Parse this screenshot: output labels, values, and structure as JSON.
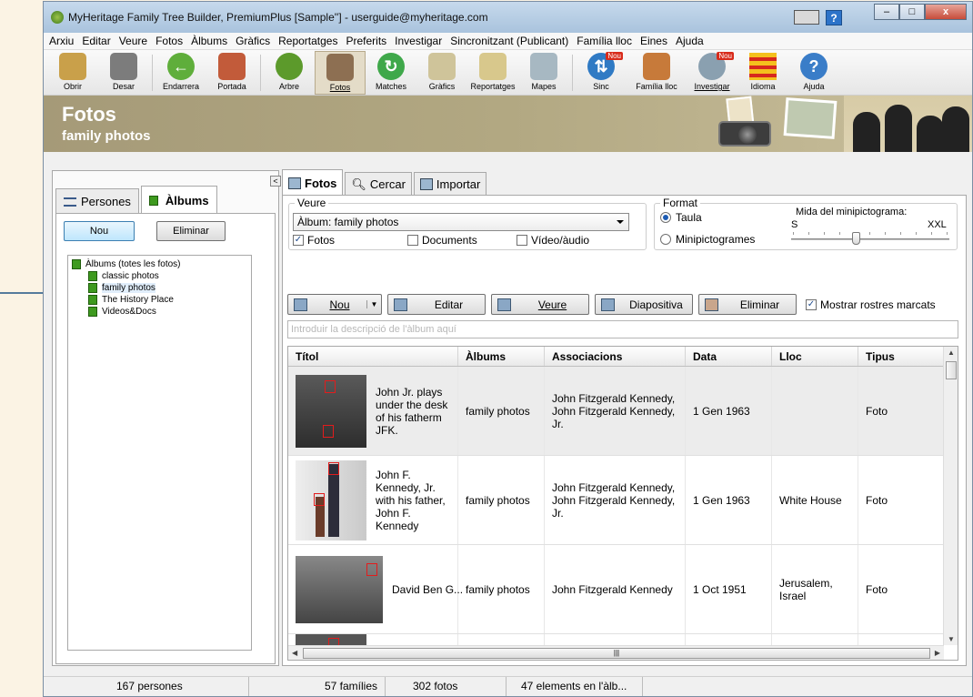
{
  "window": {
    "title": "MyHeritage Family Tree Builder, PremiumPlus [Sample''] - userguide@myheritage.com"
  },
  "menu": [
    "Arxiu",
    "Editar",
    "Veure",
    "Fotos",
    "Àlbums",
    "Gràfics",
    "Reportatges",
    "Preferits",
    "Investigar",
    "Sincronitzant (Publicant)",
    "Família lloc",
    "Eines",
    "Ajuda"
  ],
  "toolbar": {
    "open": "Obrir",
    "save": "Desar",
    "back": "Endarrera",
    "home": "Portada",
    "tree": "Arbre",
    "photos": "Fotos",
    "matches": "Matches",
    "charts": "Gràfics",
    "reports": "Reportatges",
    "maps": "Mapes",
    "sync": "Sinc",
    "family_site": "Família lloc",
    "research": "Investigar",
    "language": "Idioma",
    "help": "Ajuda",
    "new_badge": "Nou"
  },
  "banner": {
    "title": "Fotos",
    "subtitle": "family photos"
  },
  "left_panel": {
    "collapse": "<",
    "tab_people": "Persones",
    "tab_albums": "Àlbums",
    "new_button": "Nou",
    "delete_button": "Eliminar",
    "tree_root": "Àlbums (totes les fotos)",
    "albums": [
      "classic photos",
      "family photos",
      "The History Place",
      "Videos&Docs"
    ]
  },
  "right_panel": {
    "tab_photos": "Fotos",
    "tab_search": "Cercar",
    "tab_import": "Importar",
    "view_group": "Veure",
    "album_select": "Àlbum: family photos",
    "chk_photos": "Fotos",
    "chk_documents": "Documents",
    "chk_video": "Vídeo/àudio",
    "format_group": "Format",
    "radio_table": "Taula",
    "radio_thumbs": "Minipictogrames",
    "thumb_size_label": "Mida del minipictograma:",
    "size_s": "S",
    "size_xxl": "XXL",
    "btn_new": "Nou",
    "btn_edit": "Editar",
    "btn_view": "Veure",
    "btn_slideshow": "Diapositiva",
    "btn_delete": "Eliminar",
    "chk_show_faces": "Mostrar rostres marcats",
    "desc_placeholder": "Introduir la descripció de l'àlbum aquí"
  },
  "table": {
    "headers": [
      "Títol",
      "Àlbums",
      "Associacions",
      "Data",
      "Lloc",
      "Tipus"
    ],
    "rows": [
      {
        "title": "John Jr. plays under the desk of his fatherm JFK.",
        "album": "family photos",
        "associations": "John Fitzgerald Kennedy, John Fitzgerald Kennedy, Jr.",
        "date": "1 Gen 1963",
        "place": "",
        "type": "Foto"
      },
      {
        "title": "John F. Kennedy, Jr. with his father, John F. Kennedy",
        "album": "family photos",
        "associations": "John Fitzgerald Kennedy, John Fitzgerald Kennedy, Jr.",
        "date": "1 Gen 1963",
        "place": "White House",
        "type": "Foto"
      },
      {
        "title": "David Ben G...",
        "album": "family photos",
        "associations": "John Fitzgerald Kennedy",
        "date": "1 Oct 1951",
        "place": "Jerusalem, Israel",
        "type": "Foto"
      }
    ]
  },
  "status": {
    "people": "167 persones",
    "families": "57 famílies",
    "photos": "302 fotos",
    "album_items": "47 elements en l'àlb..."
  },
  "colors": {
    "accent": "#2c73c9",
    "banner": "#a59a78",
    "arrow": "#557a9c"
  }
}
